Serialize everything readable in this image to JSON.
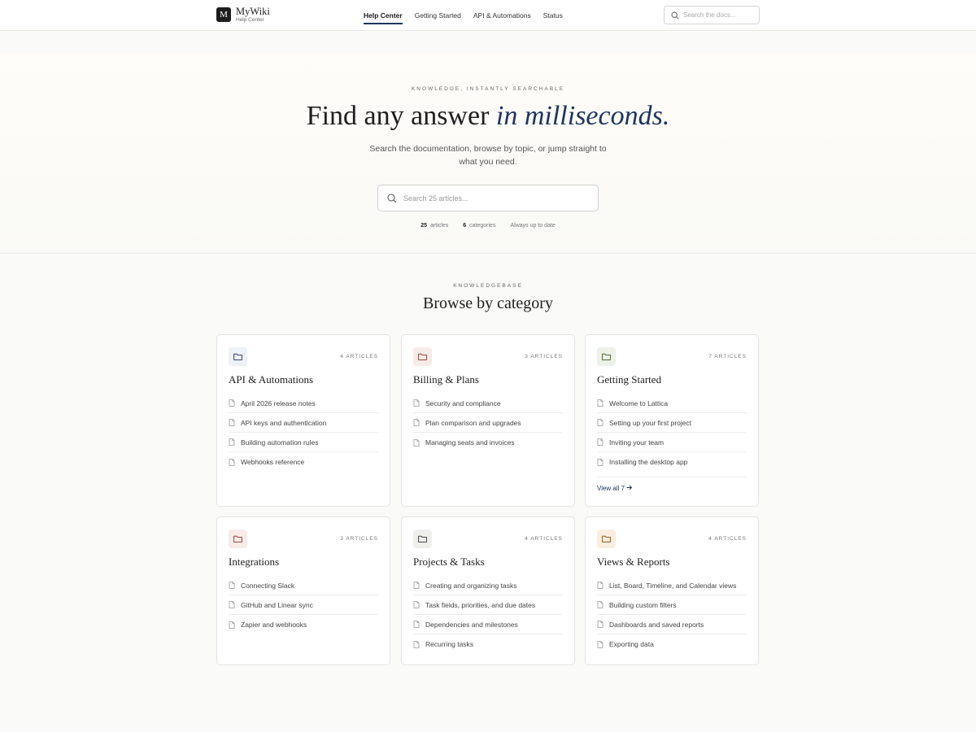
{
  "header": {
    "logo_letter": "M",
    "brand_name": "MyWiki",
    "brand_sub": "Help Center",
    "nav": [
      {
        "label": "Help Center",
        "active": true
      },
      {
        "label": "Getting Started",
        "active": false
      },
      {
        "label": "API & Automations",
        "active": false
      },
      {
        "label": "Status",
        "active": false
      }
    ],
    "search_placeholder": "Search the docs..."
  },
  "hero": {
    "eyebrow": "KNOWLEDGE, INSTANTLY SEARCHABLE",
    "title_plain": "Find any answer ",
    "title_emphasis": "in milliseconds.",
    "subtitle": "Search the documentation, browse by topic, or jump straight to what you need.",
    "search_placeholder": "Search 25 articles...",
    "stats": {
      "articles_count": "25",
      "articles_label": "articles",
      "categories_count": "6",
      "categories_label": "categories",
      "freshness": "Always up to date"
    }
  },
  "knowledgebase": {
    "eyebrow": "KNOWLEDGEBASE",
    "title": "Browse by category",
    "categories": [
      {
        "title": "API & Automations",
        "count_label": "4 ARTICLES",
        "icon": "folder-icon",
        "icon_bg": "#eef1f8",
        "icon_color": "#1f3460",
        "articles": [
          "April 2026 release notes",
          "API keys and authentication",
          "Building automation rules",
          "Webhooks reference"
        ]
      },
      {
        "title": "Billing & Plans",
        "count_label": "3 ARTICLES",
        "icon": "folder-icon",
        "icon_bg": "#f8ece8",
        "icon_color": "#8a3b2a",
        "articles": [
          "Security and compliance",
          "Plan comparison and upgrades",
          "Managing seats and invoices"
        ]
      },
      {
        "title": "Getting Started",
        "count_label": "7 ARTICLES",
        "icon": "folder-icon",
        "icon_bg": "#edf1e6",
        "icon_color": "#3f5a22",
        "articles": [
          "Welcome to Lattica",
          "Setting up your first project",
          "Inviting your team",
          "Installing the desktop app"
        ],
        "view_all": "View all 7"
      },
      {
        "title": "Integrations",
        "count_label": "3 ARTICLES",
        "icon": "folder-icon",
        "icon_bg": "#f8ece8",
        "icon_color": "#8a3b2a",
        "articles": [
          "Connecting Slack",
          "GitHub and Linear sync",
          "Zapier and webhooks"
        ]
      },
      {
        "title": "Projects & Tasks",
        "count_label": "4 ARTICLES",
        "icon": "folder-icon",
        "icon_bg": "#efefec",
        "icon_color": "#333333",
        "articles": [
          "Creating and organizing tasks",
          "Task fields, priorities, and due dates",
          "Dependencies and milestones",
          "Recurring tasks"
        ]
      },
      {
        "title": "Views & Reports",
        "count_label": "4 ARTICLES",
        "icon": "folder-icon",
        "icon_bg": "#faeee0",
        "icon_color": "#8a4a12",
        "articles": [
          "List, Board, Timeline, and Calendar views",
          "Building custom filters",
          "Dashboards and saved reports",
          "Exporting data"
        ]
      }
    ]
  }
}
